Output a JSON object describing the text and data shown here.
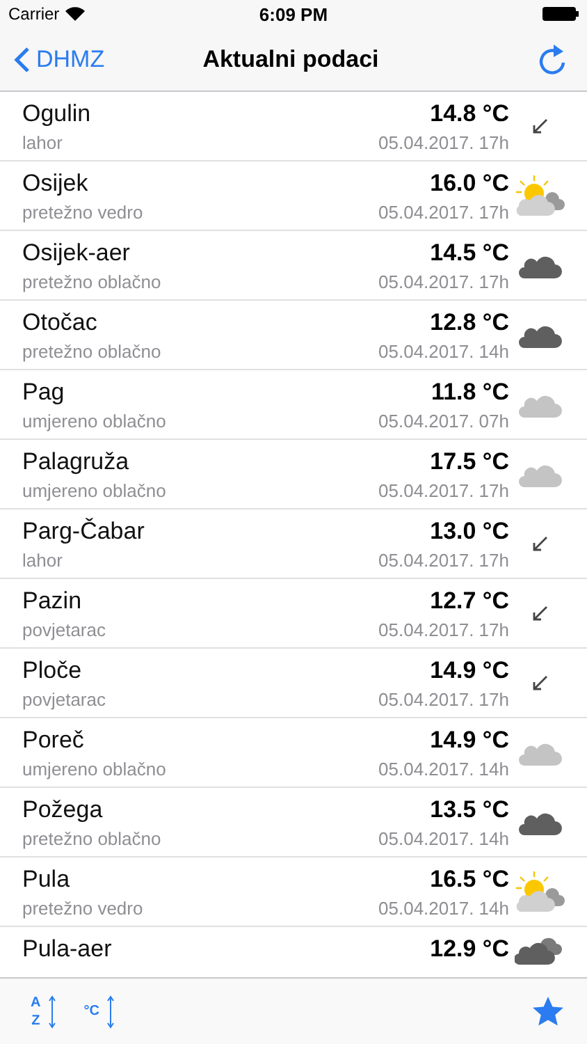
{
  "status_bar": {
    "carrier": "Carrier",
    "time": "6:09 PM"
  },
  "nav": {
    "back": "DHMZ",
    "title": "Aktualni podaci"
  },
  "stations": [
    {
      "name": "Ogulin",
      "condition": "lahor",
      "temp": "14.8 °C",
      "time": "05.04.2017. 17h",
      "kind": "wind"
    },
    {
      "name": "Osijek",
      "condition": "pretežno vedro",
      "temp": "16.0 °C",
      "time": "05.04.2017. 17h",
      "kind": "sun-cloud"
    },
    {
      "name": "Osijek-aer",
      "condition": "pretežno oblačno",
      "temp": "14.5 °C",
      "time": "05.04.2017. 17h",
      "kind": "dark-cloud"
    },
    {
      "name": "Otočac",
      "condition": "pretežno oblačno",
      "temp": "12.8 °C",
      "time": "05.04.2017. 14h",
      "kind": "dark-cloud"
    },
    {
      "name": "Pag",
      "condition": "umjereno oblačno",
      "temp": "11.8 °C",
      "time": "05.04.2017. 07h",
      "kind": "light-cloud"
    },
    {
      "name": "Palagruža",
      "condition": "umjereno oblačno",
      "temp": "17.5 °C",
      "time": "05.04.2017. 17h",
      "kind": "light-cloud"
    },
    {
      "name": "Parg-Čabar",
      "condition": "lahor",
      "temp": "13.0 °C",
      "time": "05.04.2017. 17h",
      "kind": "wind"
    },
    {
      "name": "Pazin",
      "condition": "povjetarac",
      "temp": "12.7 °C",
      "time": "05.04.2017. 17h",
      "kind": "wind"
    },
    {
      "name": "Ploče",
      "condition": "povjetarac",
      "temp": "14.9 °C",
      "time": "05.04.2017. 17h",
      "kind": "wind"
    },
    {
      "name": "Poreč",
      "condition": "umjereno oblačno",
      "temp": "14.9 °C",
      "time": "05.04.2017. 14h",
      "kind": "light-cloud"
    },
    {
      "name": "Požega",
      "condition": "pretežno oblačno",
      "temp": "13.5 °C",
      "time": "05.04.2017. 14h",
      "kind": "dark-cloud"
    },
    {
      "name": "Pula",
      "condition": "pretežno vedro",
      "temp": "16.5 °C",
      "time": "05.04.2017. 14h",
      "kind": "sun-cloud"
    },
    {
      "name": "Pula-aer",
      "temp": "12.9 °C",
      "kind": "dark-clouds"
    }
  ],
  "toolbar": {
    "sort_name_top": "A",
    "sort_name_bottom": "Z",
    "sort_temp": "°C"
  }
}
